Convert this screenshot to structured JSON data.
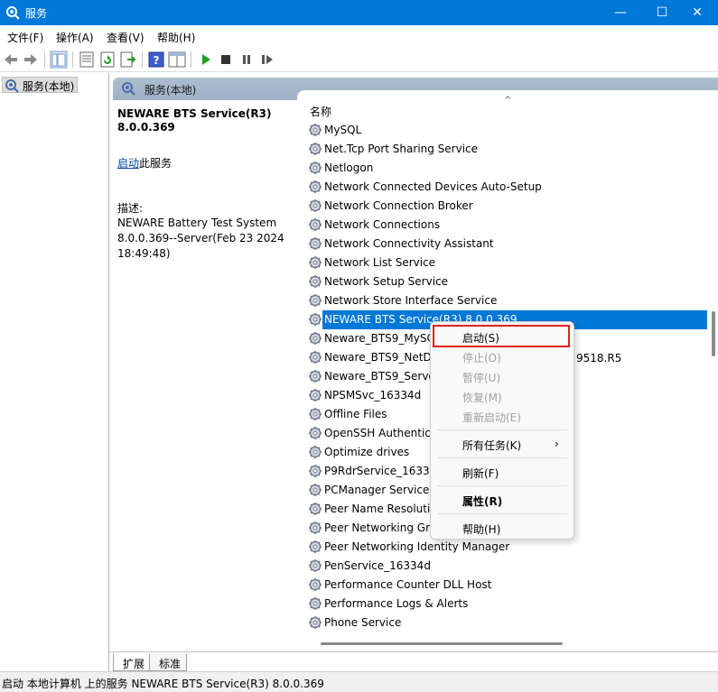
{
  "window": {
    "title": "服务",
    "min": "—",
    "max": "☐",
    "close": "✕"
  },
  "menu": [
    "文件(F)",
    "操作(A)",
    "查看(V)",
    "帮助(H)"
  ],
  "tree": {
    "item": "服务(本地)"
  },
  "header": {
    "title": "服务(本地)"
  },
  "description": {
    "service_name": "NEWARE BTS Service(R3)",
    "service_version": "8.0.0.369",
    "start_link": "启动",
    "start_suffix": "此服务",
    "desc_label": "描述:",
    "desc_text": "NEWARE Battery Test System 8.0.0.369--Server(Feb 23 2024 18:49:48)"
  },
  "list": {
    "column_name": "名称",
    "sort_arrow": "^",
    "rows": [
      "MySQL",
      "Net.Tcp Port Sharing Service",
      "Netlogon",
      "Network Connected Devices Auto-Setup",
      "Network Connection Broker",
      "Network Connections",
      "Network Connectivity Assistant",
      "Network List Service",
      "Network Setup Service",
      "Network Store Interface Service",
      "NEWARE BTS Service(R3) 8.0.0.369",
      "Neware_BTS9_MySC",
      "Neware_BTS9_NetD",
      "Neware_BTS9_Serve",
      "NPSMSvc_16334d",
      "Offline Files",
      "OpenSSH Authentica",
      "Optimize drives",
      "P9RdrService_16334",
      "PCManager Service",
      "Peer Name Resoluti",
      "Peer Networking Gr",
      "Peer Networking Identity Manager",
      "PenService_16334d",
      "Performance Counter DLL Host",
      "Performance Logs & Alerts",
      "Phone Service"
    ],
    "selected_index": 10,
    "partial_text": "9518.R5"
  },
  "context_menu": {
    "start": "启动(S)",
    "stop": "停止(O)",
    "pause": "暂停(U)",
    "resume": "恢复(M)",
    "restart": "重新启动(E)",
    "all_tasks": "所有任务(K)",
    "submenu_arrow": "›",
    "refresh": "刷新(F)",
    "properties": "属性(R)",
    "help": "帮助(H)"
  },
  "tabs": [
    "扩展",
    "标准"
  ],
  "status": "启动 本地计算机 上的服务 NEWARE BTS Service(R3) 8.0.0.369",
  "colors": {
    "accent": "#0078d7",
    "highlight_box": "#e02020"
  }
}
